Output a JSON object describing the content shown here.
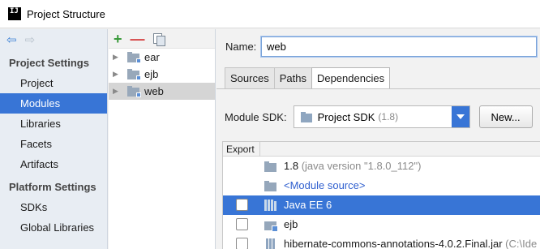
{
  "window": {
    "title": "Project Structure",
    "app_icon_text": "IJ"
  },
  "nav": {
    "groups": [
      {
        "label": "Project Settings",
        "items": [
          "Project",
          "Modules",
          "Libraries",
          "Facets",
          "Artifacts"
        ]
      },
      {
        "label": "Platform Settings",
        "items": [
          "SDKs",
          "Global Libraries"
        ]
      }
    ],
    "selected": "Modules"
  },
  "tree": {
    "toolbar": {
      "add_icon": "plus-icon",
      "remove_icon": "minus-icon",
      "copy_icon": "copy-icon"
    },
    "items": [
      {
        "label": "ear",
        "selected": false
      },
      {
        "label": "ejb",
        "selected": false
      },
      {
        "label": "web",
        "selected": true
      }
    ]
  },
  "module": {
    "name_label": "Name:",
    "name_value": "web",
    "tabs": [
      {
        "label": "Sources",
        "active": false
      },
      {
        "label": "Paths",
        "active": false
      },
      {
        "label": "Dependencies",
        "active": true
      }
    ],
    "sdk_label": "Module SDK:",
    "sdk_value": "Project SDK",
    "sdk_version": "(1.8)",
    "new_button": "New..."
  },
  "dependencies": {
    "header_export": "Export",
    "rows": [
      {
        "name": "1.8",
        "detail": "(java version \"1.8.0_112\")",
        "has_checkbox": false,
        "icon": "jdk-icon",
        "selected": false
      },
      {
        "name": "<Module source>",
        "detail": "",
        "has_checkbox": false,
        "icon": "module-source-icon",
        "selected": false
      },
      {
        "name": "Java EE 6",
        "detail": "",
        "has_checkbox": true,
        "icon": "library-icon",
        "selected": true
      },
      {
        "name": "ejb",
        "detail": "",
        "has_checkbox": true,
        "icon": "module-icon",
        "selected": false
      },
      {
        "name": "hibernate-commons-annotations-4.0.2.Final.jar",
        "detail": "(C:\\Ide",
        "has_checkbox": true,
        "icon": "jar-icon",
        "selected": false
      }
    ]
  },
  "colors": {
    "selection": "#3875d6",
    "link": "#2f5fcf"
  }
}
